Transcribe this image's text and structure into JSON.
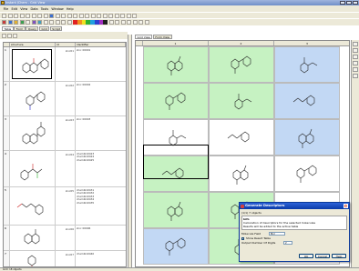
{
  "window": {
    "title": "Instant JChem - Grid View"
  },
  "menubar": {
    "items": [
      "File",
      "Edit",
      "View",
      "Data",
      "Tools",
      "Window",
      "Help"
    ]
  },
  "tabs": {
    "left": [
      "Table",
      "Form",
      "Query",
      "Grid",
      "Script"
    ],
    "left_active": "Table",
    "right": [
      "Grid View",
      "Form View"
    ],
    "right_active": "Grid View"
  },
  "left_table": {
    "headers": [
      "",
      "structure",
      "id",
      "identifier"
    ],
    "rows": [
      {
        "num": "1",
        "id": "zinc01",
        "desc": "zinc 00001"
      },
      {
        "num": "2",
        "id": "zinc02",
        "desc": "zinc 00002"
      },
      {
        "num": "3",
        "id": "zinc03",
        "desc": "zinc 00003"
      },
      {
        "num": "4",
        "id": "zinc04",
        "desc": "chembl10423\nchembl10424\nchembl10425"
      },
      {
        "num": "5",
        "id": "zinc05",
        "desc": "chembl10431\nchembl10432\nchembl10433\nchembl10434\nchembl10435"
      },
      {
        "num": "6",
        "id": "zinc06",
        "desc": "zinc 00006"
      },
      {
        "num": "7",
        "id": "zinc07",
        "desc": "chembl10440"
      }
    ]
  },
  "grid": {
    "headers": [
      "",
      "1",
      "2",
      "3"
    ],
    "rows": [
      [
        "green",
        "green",
        "blue"
      ],
      [
        "green",
        "green",
        "blue"
      ],
      [
        "white",
        "white",
        "blue"
      ],
      [
        "green",
        "white",
        "white"
      ],
      [
        "green",
        "green",
        "white"
      ],
      [
        "blue",
        "green",
        "white"
      ]
    ]
  },
  "dialog": {
    "title": "Generate Descriptors",
    "subtitle": "(1/1) 7 objects",
    "section_label": "Info",
    "info_lines": [
      "Calculation of descriptors for the selected molecules",
      "Results will be added to the active table"
    ],
    "molecule_field_label": "Molecule Field",
    "molecule_field_value": "Mol",
    "checkbox_label": "Show Result Table",
    "output_label": "Output Number Of Digits",
    "output_value": "2",
    "buttons": [
      "OK",
      "Cancel",
      "Help"
    ]
  },
  "statusbar": {
    "text": "Grid: 18 objects"
  },
  "colors": {
    "green_cell": "#c6f2c2",
    "blue_cell": "#c2d8f4",
    "dialog_title": "#0a3aa8"
  }
}
